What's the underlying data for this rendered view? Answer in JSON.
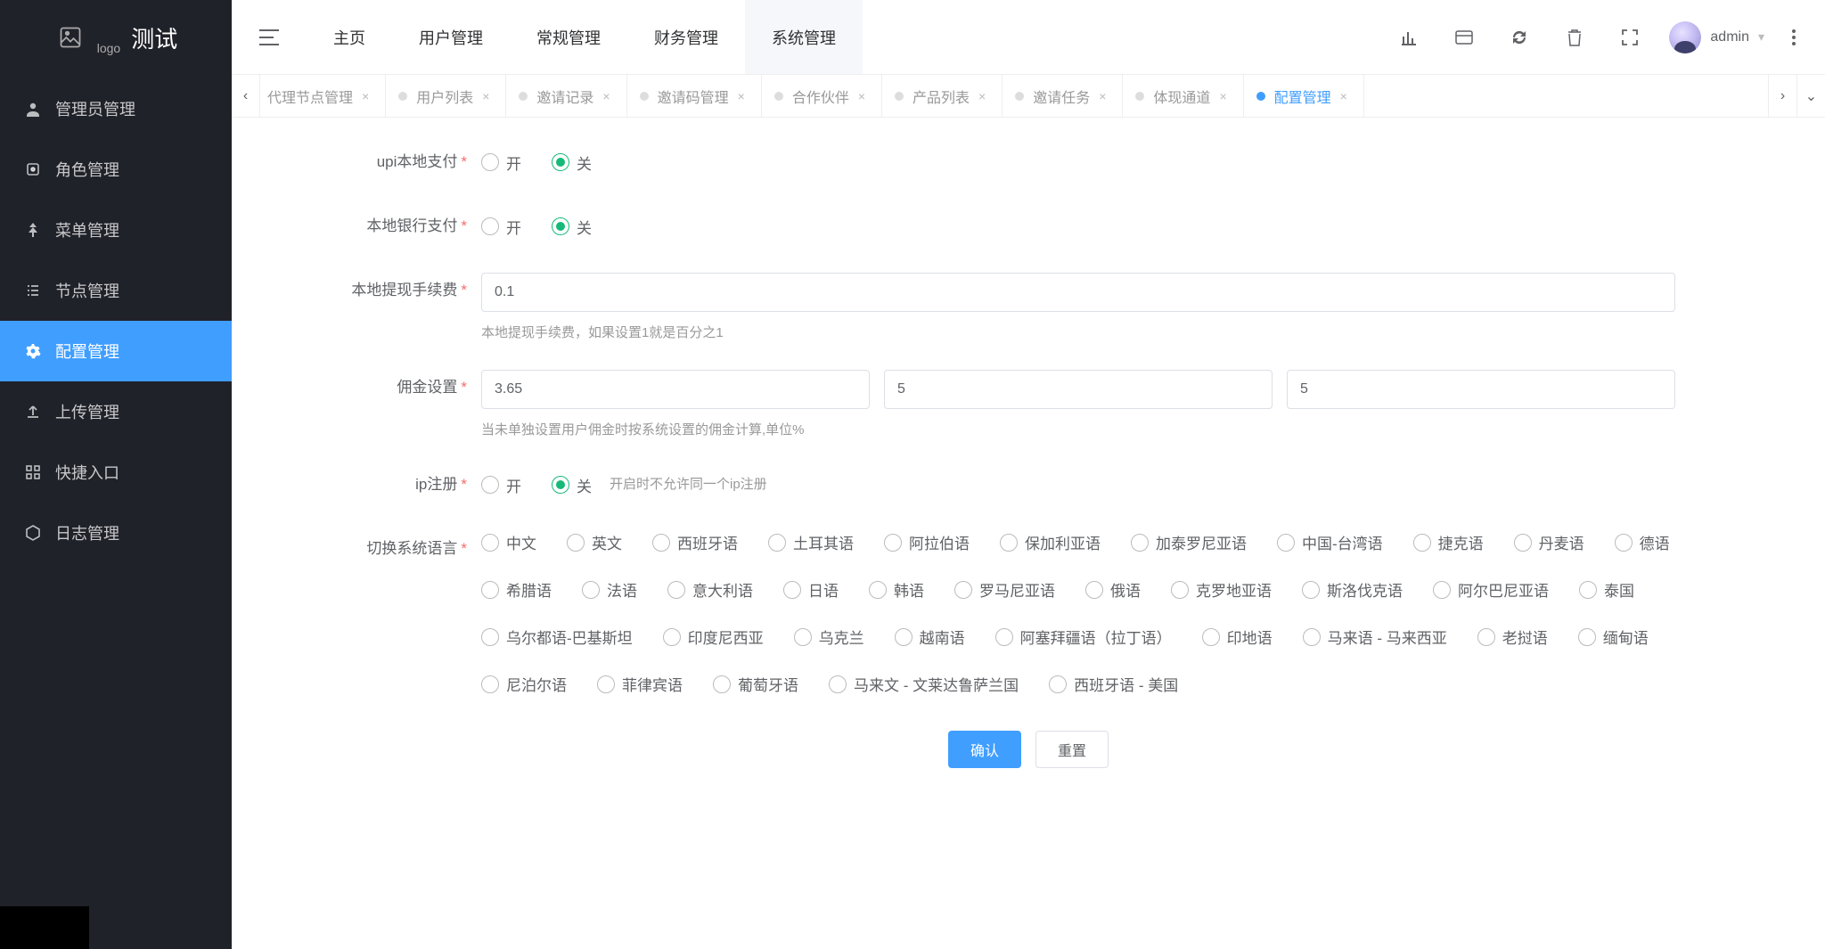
{
  "app": {
    "title": "测试",
    "logo_alt": "logo"
  },
  "header": {
    "nav": [
      {
        "label": "主页"
      },
      {
        "label": "用户管理"
      },
      {
        "label": "常规管理"
      },
      {
        "label": "财务管理"
      },
      {
        "label": "系统管理",
        "active": true
      }
    ],
    "user": "admin"
  },
  "sidebar": {
    "items": [
      {
        "label": "管理员管理",
        "icon": "user-icon"
      },
      {
        "label": "角色管理",
        "icon": "badge-icon"
      },
      {
        "label": "菜单管理",
        "icon": "tree-icon"
      },
      {
        "label": "节点管理",
        "icon": "list-icon"
      },
      {
        "label": "配置管理",
        "icon": "gear-icon",
        "active": true
      },
      {
        "label": "上传管理",
        "icon": "upload-icon"
      },
      {
        "label": "快捷入口",
        "icon": "grid-icon"
      },
      {
        "label": "日志管理",
        "icon": "hex-icon"
      }
    ]
  },
  "subtabs": [
    {
      "label": "代理节点管理"
    },
    {
      "label": "用户列表"
    },
    {
      "label": "邀请记录"
    },
    {
      "label": "邀请码管理"
    },
    {
      "label": "合作伙伴"
    },
    {
      "label": "产品列表"
    },
    {
      "label": "邀请任务"
    },
    {
      "label": "体现通道"
    },
    {
      "label": "配置管理",
      "active": true
    }
  ],
  "form": {
    "upi_local_pay": {
      "label": "upi本地支付",
      "on": "开",
      "off": "关",
      "value": "off"
    },
    "local_bank_pay": {
      "label": "本地银行支付",
      "on": "开",
      "off": "关",
      "value": "off"
    },
    "local_withdraw_fee": {
      "label": "本地提现手续费",
      "value": "0.1",
      "help": "本地提现手续费，如果设置1就是百分之1"
    },
    "commission": {
      "label": "佣金设置",
      "values": [
        "3.65",
        "5",
        "5"
      ],
      "help": "当未单独设置用户佣金时按系统设置的佣金计算,单位%"
    },
    "ip_register": {
      "label": "ip注册",
      "on": "开",
      "off": "关",
      "value": "off",
      "help": "开启时不允许同一个ip注册"
    },
    "language": {
      "label": "切换系统语言",
      "options": [
        "中文",
        "英文",
        "西班牙语",
        "土耳其语",
        "阿拉伯语",
        "保加利亚语",
        "加泰罗尼亚语",
        "中国-台湾语",
        "捷克语",
        "丹麦语",
        "德语",
        "希腊语",
        "法语",
        "意大利语",
        "日语",
        "韩语",
        "罗马尼亚语",
        "俄语",
        "克罗地亚语",
        "斯洛伐克语",
        "阿尔巴尼亚语",
        "泰国",
        "乌尔都语-巴基斯坦",
        "印度尼西亚",
        "乌克兰",
        "越南语",
        "阿塞拜疆语（拉丁语）",
        "印地语",
        "马来语 - 马来西亚",
        "老挝语",
        "缅甸语",
        "尼泊尔语",
        "菲律宾语",
        "葡萄牙语",
        "马来文 - 文莱达鲁萨兰国",
        "西班牙语 - 美国"
      ]
    },
    "buttons": {
      "submit": "确认",
      "reset": "重置"
    }
  }
}
